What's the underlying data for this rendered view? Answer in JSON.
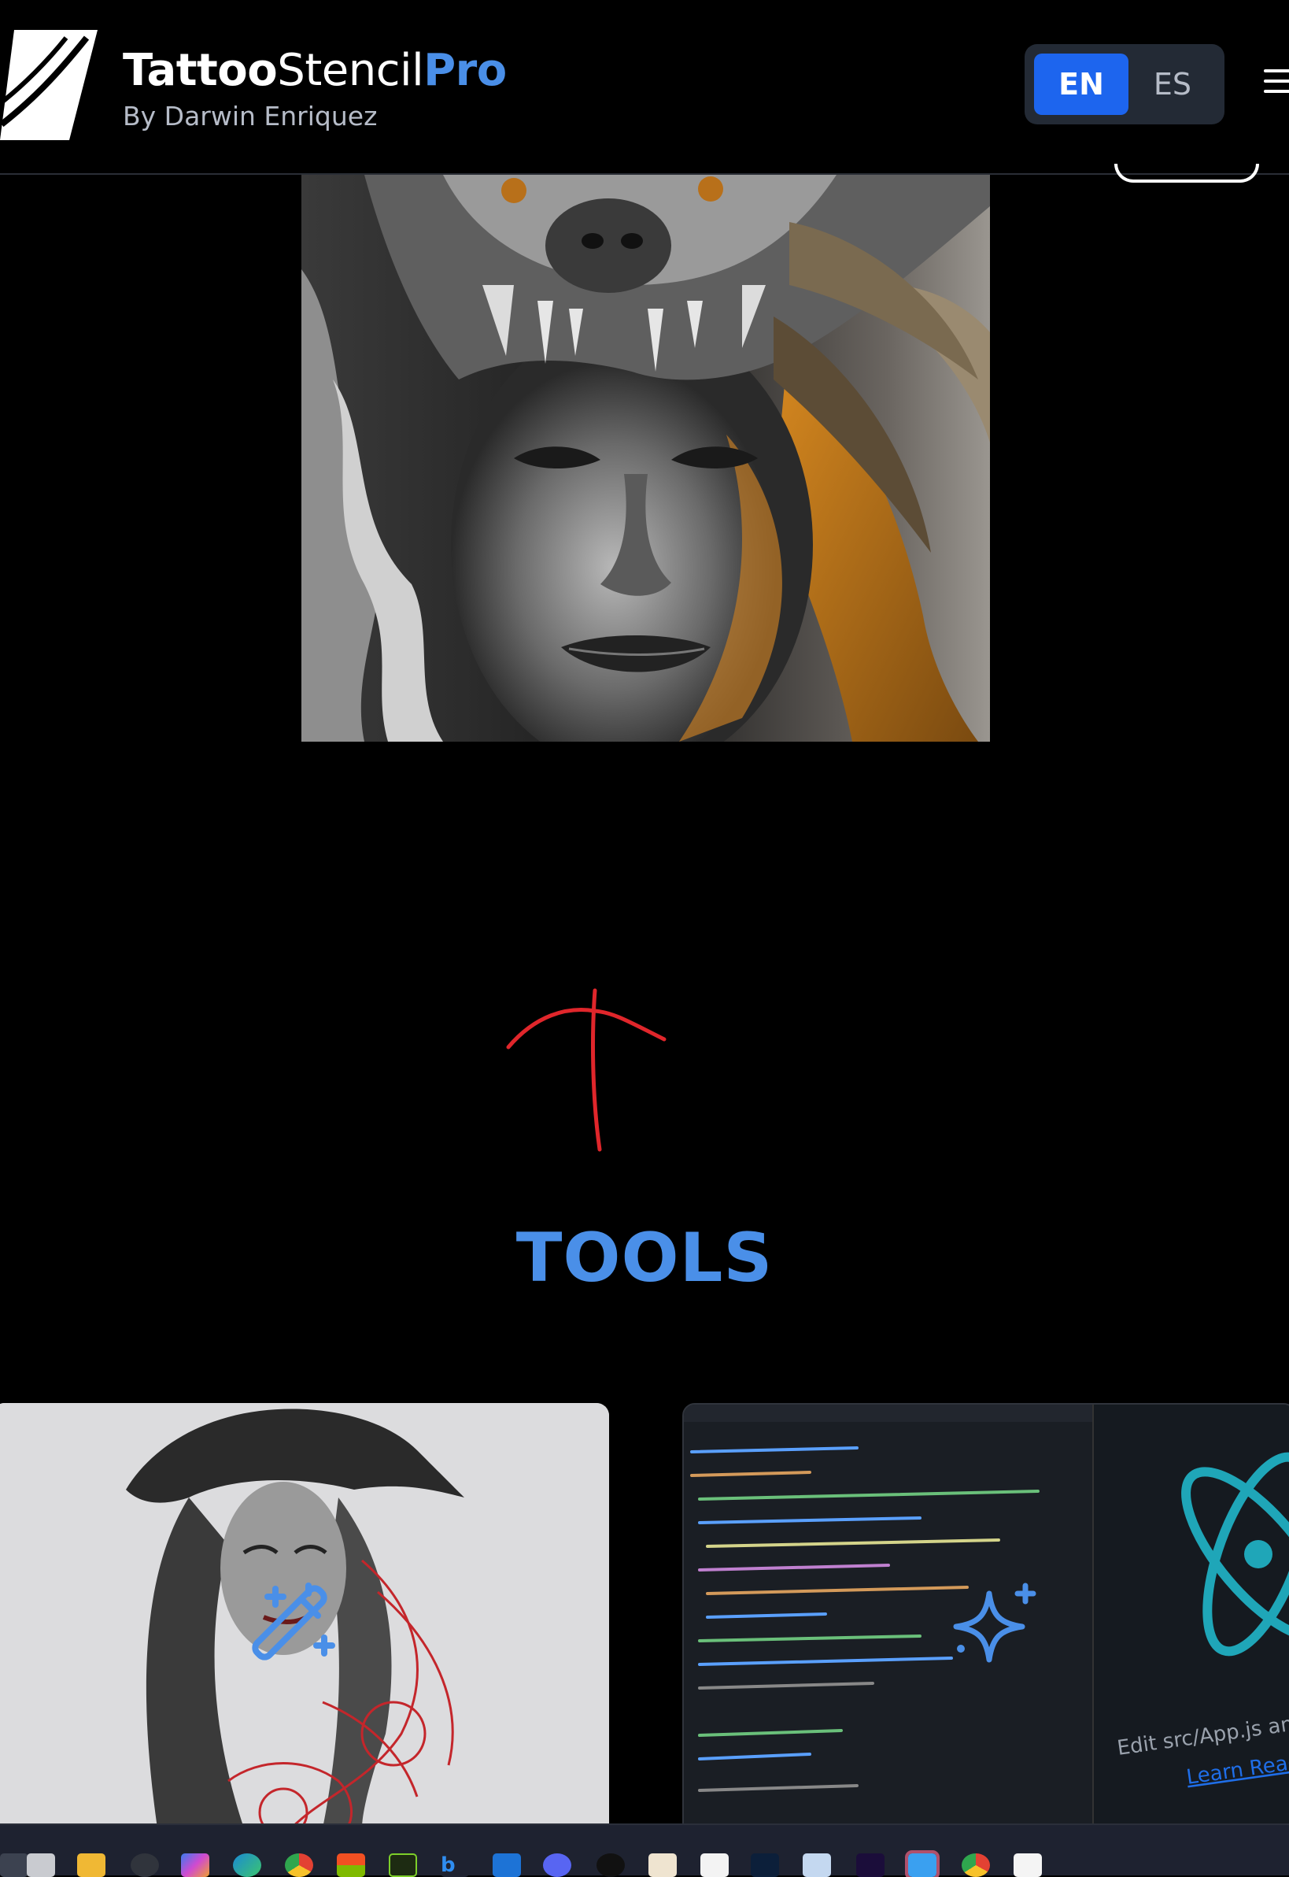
{
  "header": {
    "brand_part1": "Tattoo",
    "brand_part2": "Stencil",
    "brand_part3": "Pro",
    "subtitle": "By Darwin Enriquez",
    "lang_options": [
      "EN",
      "ES"
    ],
    "active_lang": "EN"
  },
  "sections": {
    "tools_title": "TOOLS"
  },
  "colors": {
    "accent": "#4a8fe8",
    "active_button": "#1d65ee",
    "background": "#000000",
    "annotation": "#e0262b"
  },
  "icons": {
    "card_left": "magic-wand-icon",
    "card_right": "sparkle-icon",
    "menu": "hamburger-menu-icon"
  },
  "taskbar": {
    "apps": [
      "start",
      "task-view",
      "file-explorer",
      "app",
      "copilot",
      "edge",
      "chrome",
      "store",
      "app",
      "bing",
      "outlook",
      "discord",
      "tiktok",
      "app",
      "notepad",
      "photoshop",
      "photoshop",
      "premiere",
      "notepad",
      "chrome",
      "app"
    ]
  },
  "card_right_code": {
    "line1": "Edit src/App.js and s",
    "line2": "Learn React"
  }
}
